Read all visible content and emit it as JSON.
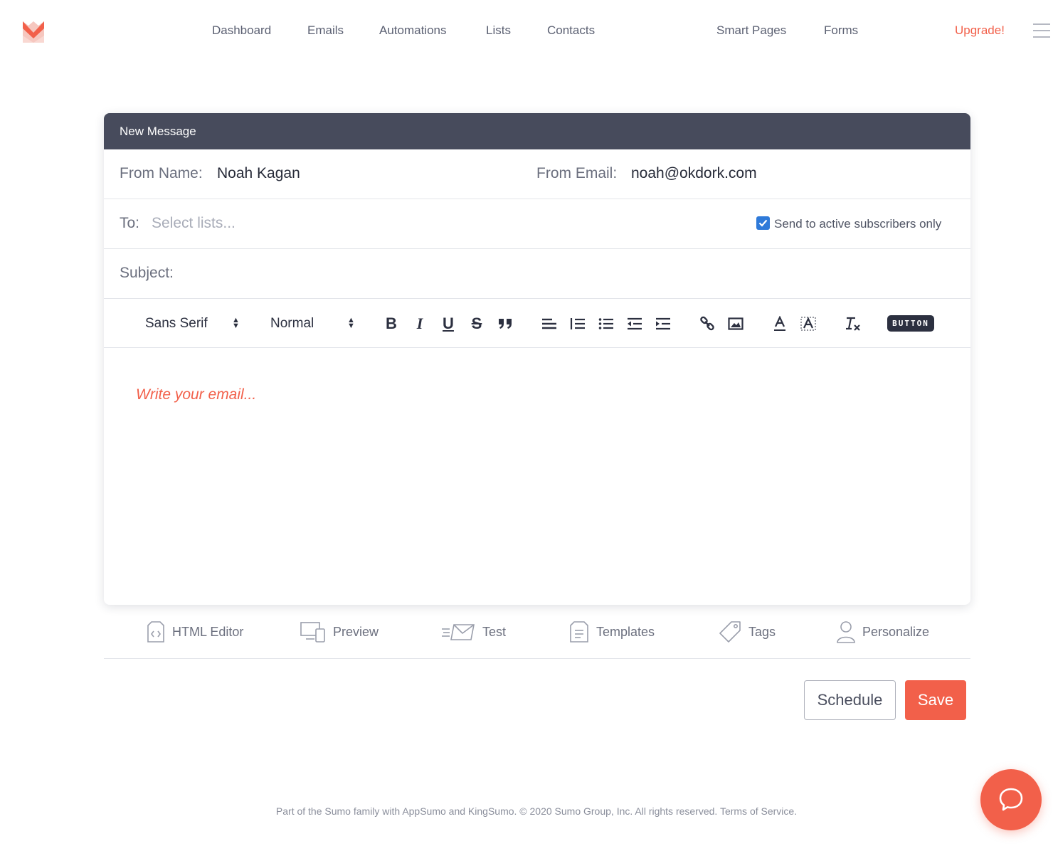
{
  "nav": {
    "items": [
      "Dashboard",
      "Emails",
      "Automations",
      "Lists",
      "Contacts",
      "Smart Pages",
      "Forms"
    ],
    "upgrade": "Upgrade!"
  },
  "composer": {
    "header": "New Message",
    "from_name_label": "From Name:",
    "from_name": "Noah Kagan",
    "from_email_label": "From Email:",
    "from_email": "noah@okdork.com",
    "to_label": "To:",
    "to_placeholder": "Select lists...",
    "active_only_checked": true,
    "active_only_label": "Send to active subscribers only",
    "subject_label": "Subject:",
    "subject_value": "",
    "editor_placeholder": "Write your email..."
  },
  "toolbar": {
    "font": "Sans Serif",
    "size": "Normal",
    "bold": "B",
    "italic": "I",
    "underline": "U",
    "strike": "S",
    "button_label": "BUTTON"
  },
  "actions": {
    "html_editor": "HTML Editor",
    "preview": "Preview",
    "test": "Test",
    "templates": "Templates",
    "tags": "Tags",
    "personalize": "Personalize"
  },
  "buttons": {
    "schedule": "Schedule",
    "save": "Save"
  },
  "footer": "Part of the Sumo family with AppSumo and KingSumo. © 2020 Sumo Group, Inc. All rights reserved. Terms of Service.",
  "colors": {
    "accent": "#f2604a",
    "header": "#474b5c",
    "checkbox": "#2f7ad9"
  }
}
